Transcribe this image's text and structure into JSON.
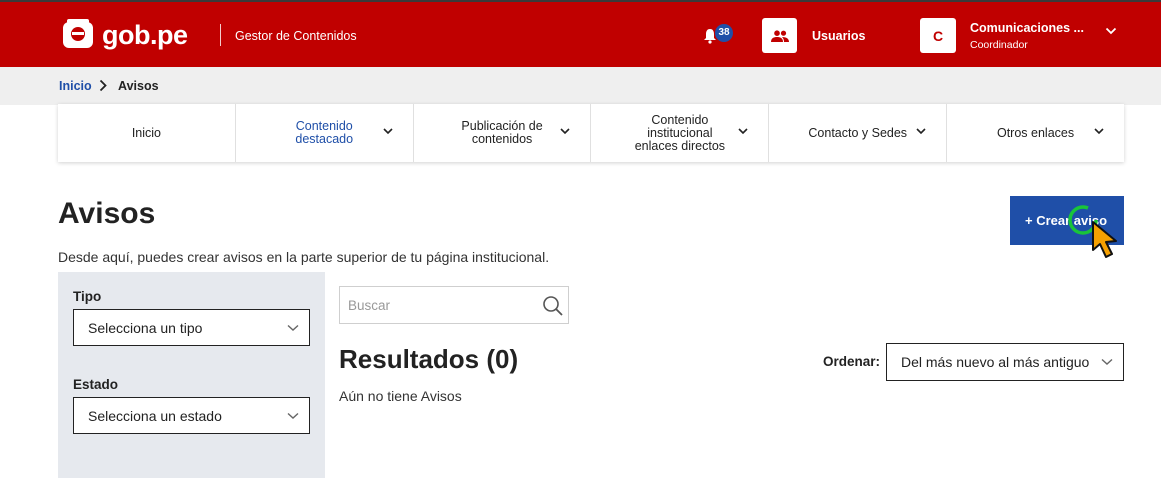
{
  "header": {
    "logo_text": "gob.pe",
    "app_title": "Gestor de Contenidos",
    "notifications_count": "38",
    "users_label": "Usuarios",
    "account": {
      "initial": "C",
      "name": "Comunicaciones ...",
      "role": "Coordinador"
    }
  },
  "breadcrumb": {
    "home": "Inicio",
    "current": "Avisos"
  },
  "tabs": [
    {
      "label": "Inicio",
      "has_dropdown": false,
      "active": false
    },
    {
      "label": "Contenido destacado",
      "has_dropdown": true,
      "active": true
    },
    {
      "label": "Publicación de contenidos",
      "has_dropdown": true,
      "active": false
    },
    {
      "label": "Contenido institucional enlaces directos",
      "has_dropdown": true,
      "active": false
    },
    {
      "label": "Contacto y Sedes",
      "has_dropdown": true,
      "active": false
    },
    {
      "label": "Otros enlaces",
      "has_dropdown": true,
      "active": false
    }
  ],
  "page": {
    "title": "Avisos",
    "description": "Desde aquí, puedes crear avisos en la parte superior de tu página institucional.",
    "create_button": "+ Crear aviso"
  },
  "filters": {
    "type_label": "Tipo",
    "type_value": "Selecciona un tipo",
    "state_label": "Estado",
    "state_value": "Selecciona un estado"
  },
  "search": {
    "placeholder": "Buscar"
  },
  "results": {
    "title": "Resultados (0)",
    "empty_message": "Aún no tiene Avisos",
    "order_label": "Ordenar:",
    "order_value": "Del más nuevo al más antiguo"
  },
  "colors": {
    "header_red": "#c00000",
    "primary_blue": "#1f4fa8",
    "filter_panel_bg": "#e6e9ee",
    "breadcrumb_bg": "#efefef"
  }
}
